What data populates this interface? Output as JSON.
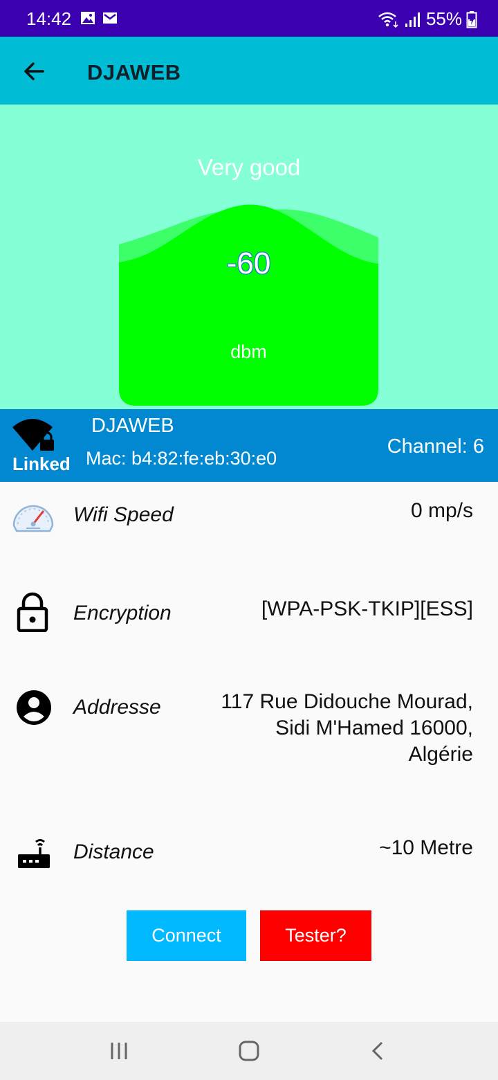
{
  "status_bar": {
    "time": "14:42",
    "battery": "55%",
    "icons": [
      "image-icon",
      "gmail-icon",
      "wifi-icon",
      "signal-icon",
      "battery-icon"
    ]
  },
  "app_bar": {
    "title": "DJAWEB",
    "back_icon": "arrow-back-icon"
  },
  "signal": {
    "quality": "Very good",
    "value": "-60",
    "unit": "dbm",
    "colors": {
      "background": "#84ffd6",
      "fill": "#00ff00",
      "wave": "#3dff6a"
    }
  },
  "network": {
    "name": "DJAWEB",
    "status": "Linked",
    "mac": "Mac: b4:82:fe:eb:30:e0",
    "channel": "Channel: 6"
  },
  "details": {
    "speed": {
      "label": "Wifi Speed",
      "value": "0 mp/s",
      "icon": "speedometer-icon"
    },
    "encryption": {
      "label": "Encryption",
      "value": "[WPA-PSK-TKIP][ESS]",
      "icon": "lock-icon"
    },
    "address": {
      "label": "Addresse",
      "value_lines": [
        "117 Rue Didouche Mourad,",
        "Sidi M'Hamed 16000,",
        "Algérie"
      ],
      "icon": "account-circle-icon"
    },
    "distance": {
      "label": "Distance",
      "value": "~10 Metre",
      "icon": "router-icon"
    }
  },
  "buttons": {
    "connect": "Connect",
    "tester": "Tester?"
  },
  "nav": {
    "items": [
      "recents-icon",
      "home-icon",
      "back-icon"
    ]
  }
}
